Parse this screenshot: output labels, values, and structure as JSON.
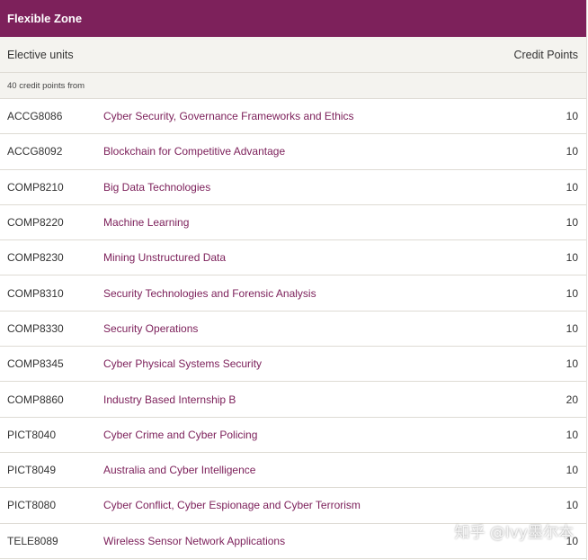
{
  "zone": {
    "title": "Flexible Zone"
  },
  "table": {
    "col_units": "Elective units",
    "col_credits": "Credit Points",
    "subheader": "40 credit points from",
    "rows": [
      {
        "code": "ACCG8086",
        "title": "Cyber Security, Governance Frameworks and Ethics",
        "cp": "10"
      },
      {
        "code": "ACCG8092",
        "title": "Blockchain for Competitive Advantage",
        "cp": "10"
      },
      {
        "code": "COMP8210",
        "title": "Big Data Technologies",
        "cp": "10"
      },
      {
        "code": "COMP8220",
        "title": "Machine Learning",
        "cp": "10"
      },
      {
        "code": "COMP8230",
        "title": "Mining Unstructured Data",
        "cp": "10"
      },
      {
        "code": "COMP8310",
        "title": "Security Technologies and Forensic Analysis",
        "cp": "10"
      },
      {
        "code": "COMP8330",
        "title": "Security Operations",
        "cp": "10"
      },
      {
        "code": "COMP8345",
        "title": "Cyber Physical Systems Security",
        "cp": "10"
      },
      {
        "code": "COMP8860",
        "title": "Industry Based Internship B",
        "cp": "20"
      },
      {
        "code": "PICT8040",
        "title": "Cyber Crime and Cyber Policing",
        "cp": "10"
      },
      {
        "code": "PICT8049",
        "title": "Australia and Cyber Intelligence",
        "cp": "10"
      },
      {
        "code": "PICT8080",
        "title": "Cyber Conflict, Cyber Espionage and Cyber Terrorism",
        "cp": "10"
      },
      {
        "code": "TELE8089",
        "title": "Wireless Sensor Network Applications",
        "cp": "10"
      }
    ]
  },
  "watermark": "知乎 @Ivy墨尔本",
  "colors": {
    "brand": "#7d215b",
    "header_bg": "#f4f3ef",
    "divider": "#dedbd4"
  }
}
